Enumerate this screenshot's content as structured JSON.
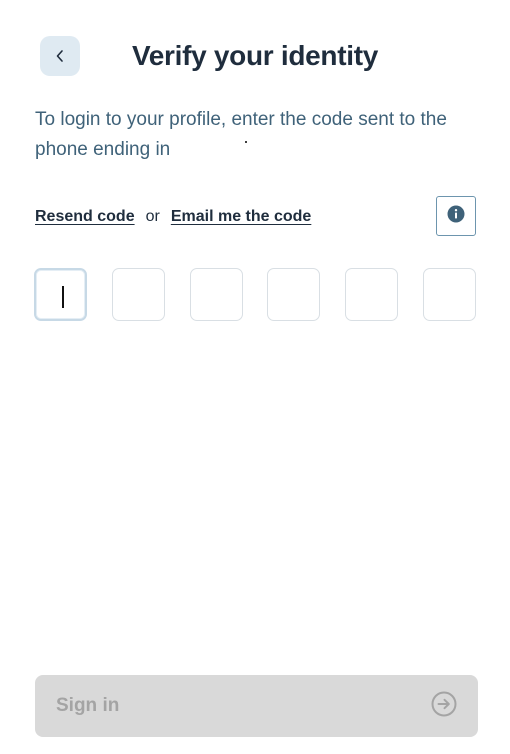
{
  "header": {
    "title": "Verify your identity",
    "back_icon": "chevron-left-icon"
  },
  "description": "To login to your profile, enter the code sent to the phone ending in",
  "actions": {
    "resend_label": "Resend code",
    "or_label": "or",
    "email_label": "Email me the code",
    "info_icon": "info-icon"
  },
  "code": {
    "length": 6,
    "values": [
      "",
      "",
      "",
      "",
      "",
      ""
    ],
    "active_index": 0
  },
  "signin": {
    "label": "Sign in",
    "icon": "arrow-right-circle-icon",
    "disabled": true
  },
  "colors": {
    "title": "#1f2d3d",
    "text": "#3f6279",
    "back_button_bg": "#dfeaf2",
    "disabled_button_bg": "#d9d9d9",
    "disabled_text": "#a4a4a4"
  }
}
